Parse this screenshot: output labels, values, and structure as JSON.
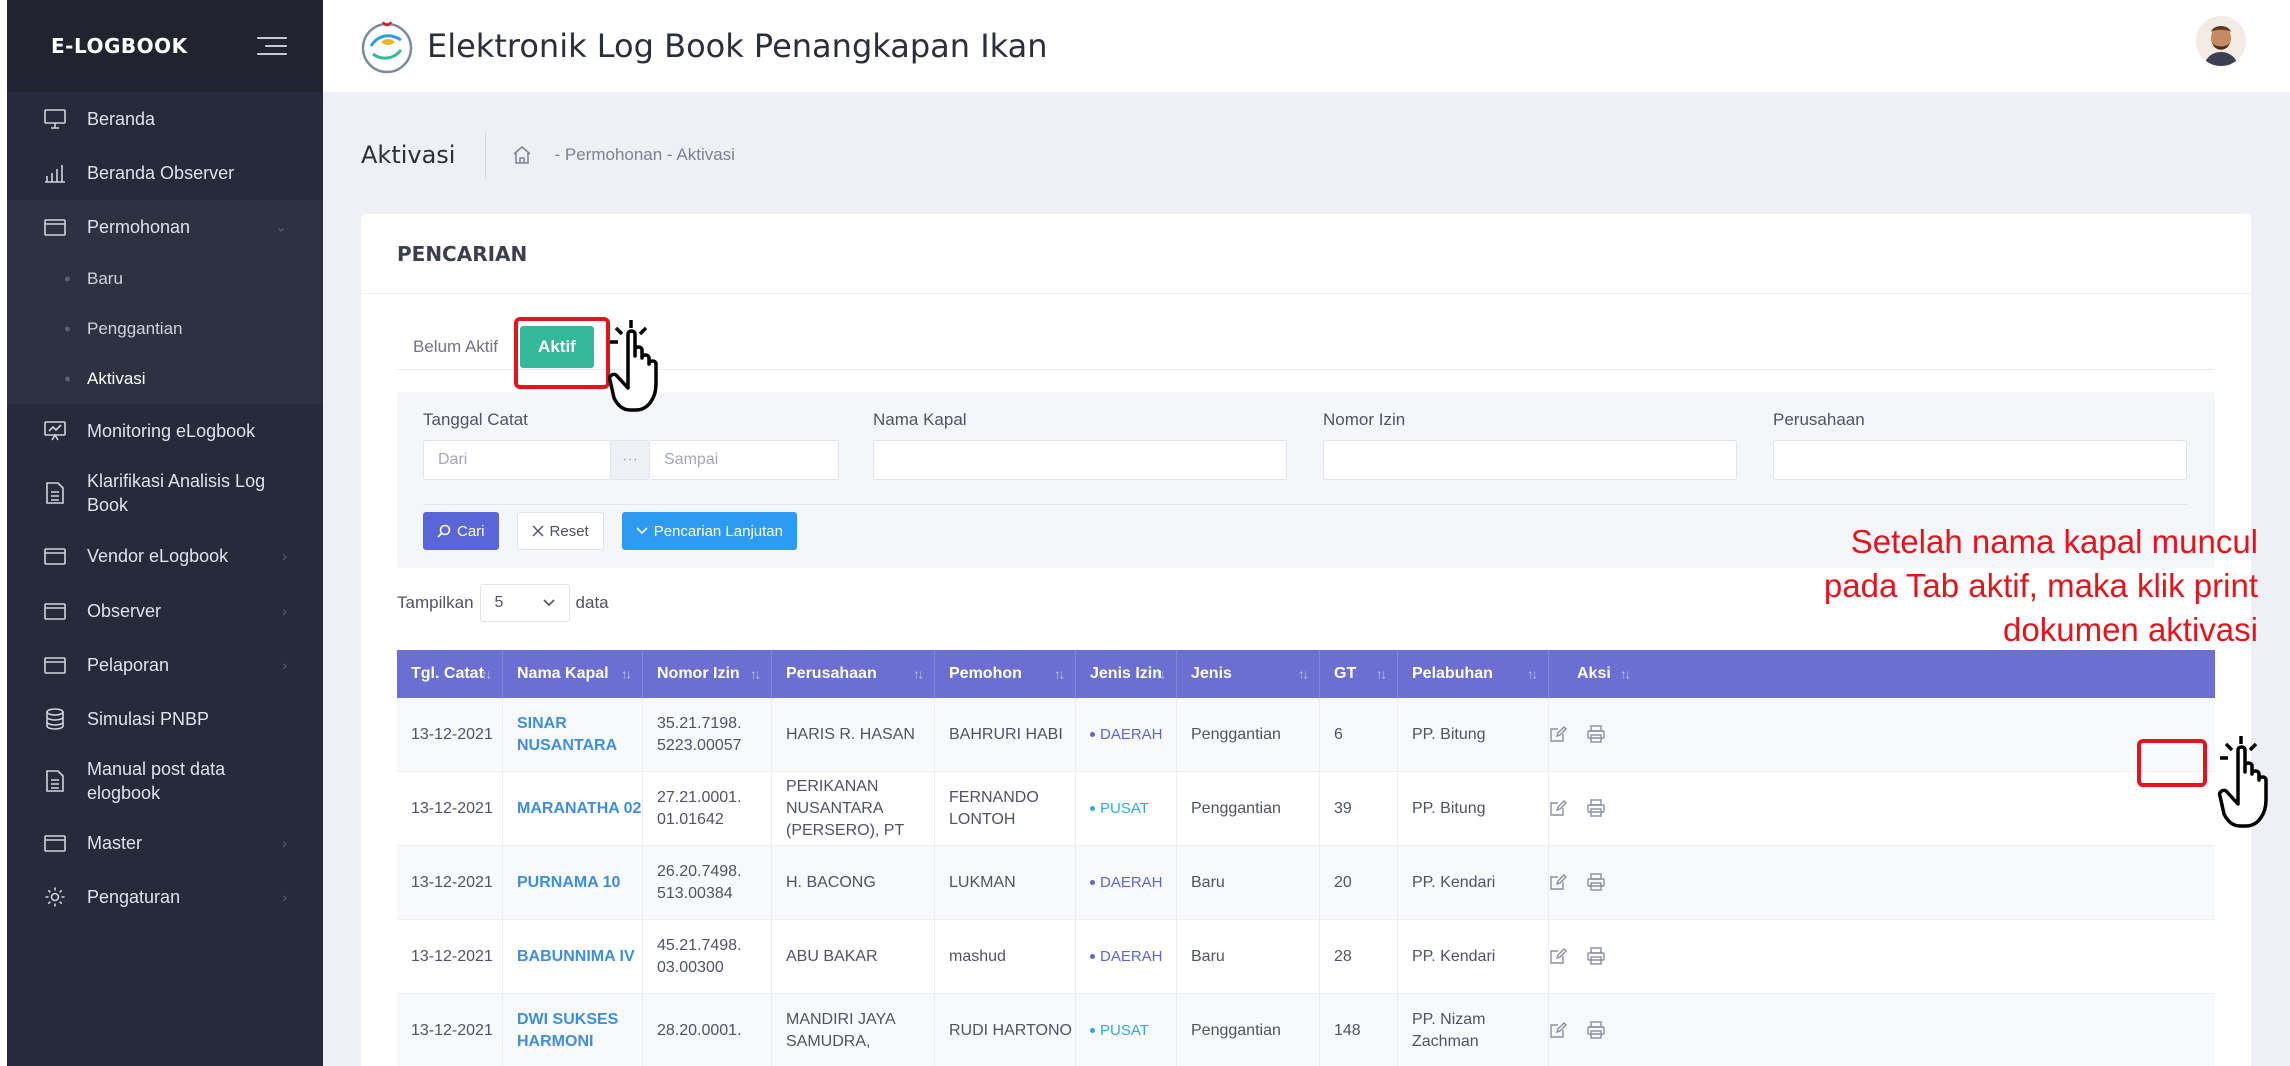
{
  "brand": {
    "name": "E-LOGBOOK"
  },
  "header": {
    "title": "Elektronik Log Book Penangkapan Ikan"
  },
  "sidebar": {
    "items": [
      {
        "label": "Beranda",
        "icon": "monitor-icon"
      },
      {
        "label": "Beranda Observer",
        "icon": "bar-chart-icon"
      },
      {
        "label": "Permohonan",
        "icon": "folder-icon",
        "expanded": true
      },
      {
        "label": "Monitoring eLogbook",
        "icon": "presentation-icon"
      },
      {
        "label": "Klarifikasi Analisis Log Book",
        "icon": "document-icon"
      },
      {
        "label": "Vendor eLogbook",
        "icon": "folder-icon"
      },
      {
        "label": "Observer",
        "icon": "folder-icon"
      },
      {
        "label": "Pelaporan",
        "icon": "folder-icon"
      },
      {
        "label": "Simulasi PNBP",
        "icon": "coins-icon"
      },
      {
        "label": "Manual post data elogbook",
        "icon": "document-icon"
      },
      {
        "label": "Master",
        "icon": "folder-icon"
      },
      {
        "label": "Pengaturan",
        "icon": "gear-icon"
      }
    ],
    "sub_items": [
      {
        "label": "Baru"
      },
      {
        "label": "Penggantian"
      },
      {
        "label": "Aktivasi"
      }
    ]
  },
  "page": {
    "title": "Aktivasi",
    "breadcrumb": "-  Permohonan  -  Aktivasi"
  },
  "search": {
    "card_title": "PENCARIAN",
    "tabs": [
      {
        "label": "Belum Aktif"
      },
      {
        "label": "Aktif",
        "active": true
      }
    ],
    "fields": {
      "tanggal_label": "Tanggal Catat",
      "dari_placeholder": "Dari",
      "sampai_placeholder": "Sampai",
      "range_sep": "···",
      "nama_kapal_label": "Nama Kapal",
      "nomor_izin_label": "Nomor Izin",
      "perusahaan_label": "Perusahaan"
    },
    "buttons": {
      "cari": "Cari",
      "reset": "Reset",
      "lanjutan": "Pencarian Lanjutan"
    }
  },
  "listing": {
    "show_prefix": "Tampilkan",
    "page_size": "5",
    "show_suffix": "data"
  },
  "table": {
    "columns": [
      "Tgl. Catat",
      "Nama Kapal",
      "Nomor Izin",
      "Perusahaan",
      "Pemohon",
      "Jenis Izin",
      "Jenis",
      "GT",
      "Pelabuhan",
      "Aksi"
    ],
    "rows": [
      {
        "tgl": "13-12-2021",
        "kapal": "SINAR NUSANTARA",
        "izin1": "35.21.7198.",
        "izin2": "5223.00057",
        "perusahaan1": "HARIS R. HASAN",
        "perusahaan2": "",
        "pemohon": "BAHRURI HABI",
        "jenis_izin": "DAERAH",
        "jenis": "Penggantian",
        "gt": "6",
        "pelabuhan1": "PP. Bitung",
        "pelabuhan2": ""
      },
      {
        "tgl": "13-12-2021",
        "kapal": "MARANATHA 02",
        "izin1": "27.21.0001.",
        "izin2": "01.01642",
        "perusahaan1": "PERIKANAN NUSANTARA",
        "perusahaan2": "(PERSERO), PT",
        "pemohon": "FERNANDO LONTOH",
        "jenis_izin": "PUSAT",
        "jenis": "Penggantian",
        "gt": "39",
        "pelabuhan1": "PP. Bitung",
        "pelabuhan2": ""
      },
      {
        "tgl": "13-12-2021",
        "kapal": "PURNAMA 10",
        "izin1": "26.20.7498.",
        "izin2": "513.00384",
        "perusahaan1": "H. BACONG",
        "perusahaan2": "",
        "pemohon": "LUKMAN",
        "jenis_izin": "DAERAH",
        "jenis": "Baru",
        "gt": "20",
        "pelabuhan1": "PP. Kendari",
        "pelabuhan2": ""
      },
      {
        "tgl": "13-12-2021",
        "kapal": "BABUNNIMA IV",
        "izin1": "45.21.7498.",
        "izin2": "03.00300",
        "perusahaan1": "ABU BAKAR",
        "perusahaan2": "",
        "pemohon": "mashud",
        "jenis_izin": "DAERAH",
        "jenis": "Baru",
        "gt": "28",
        "pelabuhan1": "PP. Kendari",
        "pelabuhan2": ""
      },
      {
        "tgl": "13-12-2021",
        "kapal": "DWI SUKSES HARMONI",
        "izin1": "28.20.0001.",
        "izin2": "",
        "perusahaan1": "MANDIRI JAYA SAMUDRA,",
        "perusahaan2": "",
        "pemohon": "RUDI HARTONO",
        "jenis_izin": "PUSAT",
        "jenis": "Penggantian",
        "gt": "148",
        "pelabuhan1": "PP. Nizam Zachman",
        "pelabuhan2": ""
      }
    ]
  },
  "annotation": {
    "text_line1": "Setelah nama kapal muncul",
    "text_line2": "pada Tab aktif, maka klik print",
    "text_line3": "dokumen aktivasi"
  },
  "colors": {
    "sidebar_bg": "#262a3a",
    "table_header": "#6b6fd2",
    "tab_active": "#35b89a",
    "link": "#3f8edb",
    "annotation": "#e5141c",
    "daerah": "#5b66d6",
    "pusat": "#2ea8e0"
  }
}
